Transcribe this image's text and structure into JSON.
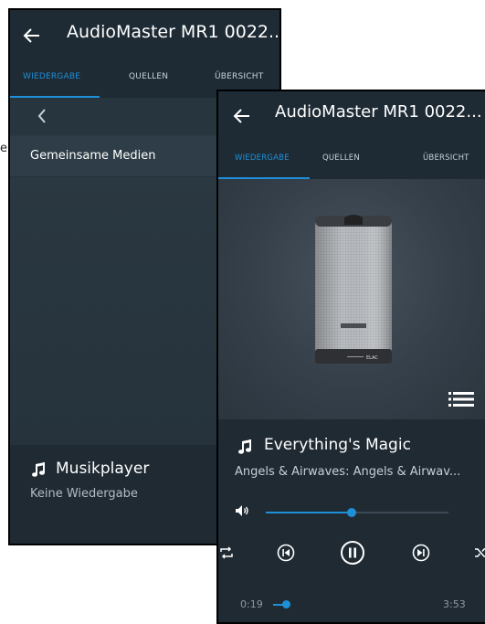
{
  "back_screen": {
    "title": "AudioMaster MR1 0022...",
    "tabs": [
      {
        "label": "WIEDERGABE",
        "active": true
      },
      {
        "label": "QUELLEN",
        "active": false
      },
      {
        "label": "ÜBERSICHT",
        "active": false
      }
    ],
    "list_item": "Gemeinsame Medien",
    "player_title": "Musikplayer",
    "player_status": "Keine Wiedergabe"
  },
  "front_screen": {
    "title": "AudioMaster MR1 0022...",
    "tabs": [
      {
        "label": "WIEDERGABE",
        "active": true
      },
      {
        "label": "QUELLEN",
        "active": false
      },
      {
        "label": "ÜBERSICHT",
        "active": false
      }
    ],
    "track_title": "Everything's Magic",
    "track_artist": "Angels & Airwaves: Angels & Airwav...",
    "volume_level": 0.47,
    "elapsed": "0:19",
    "duration": "3:53",
    "progress_fraction": 0.08
  },
  "overflow_fragment": "er",
  "icons": [
    "back-arrow-icon",
    "chevron-left-icon",
    "music-note-icon",
    "playlist-icon",
    "volume-icon",
    "repeat-icon",
    "previous-icon",
    "pause-icon",
    "next-icon",
    "shuffle-icon"
  ],
  "colors": {
    "accent": "#1e90d8",
    "background": "#1f2a33",
    "header": "#1e2b35"
  }
}
